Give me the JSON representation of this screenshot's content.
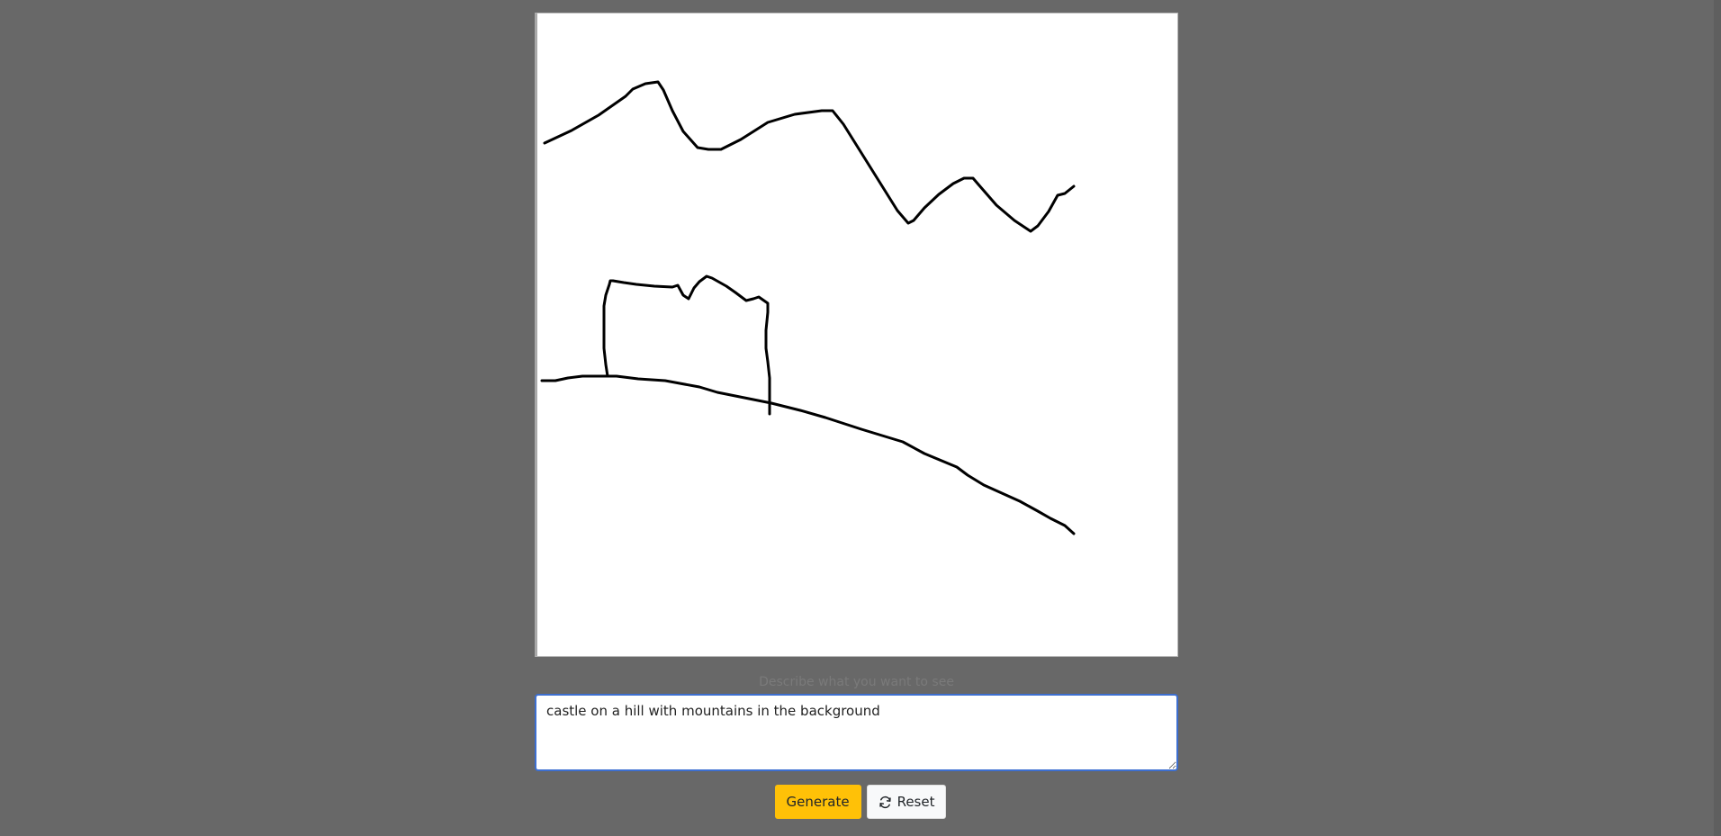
{
  "canvas": {
    "background": "#ffffff",
    "stroke_color": "#000000"
  },
  "prompt": {
    "label": "Describe what you want to see",
    "value": "castle on a hill with mountains in the background"
  },
  "buttons": {
    "generate_label": "Generate",
    "reset_label": "Reset",
    "reset_icon": "refresh-icon"
  },
  "colors": {
    "page_bg": "#686868",
    "accent": "#ffc107",
    "focus_border": "#3d6fd0"
  }
}
